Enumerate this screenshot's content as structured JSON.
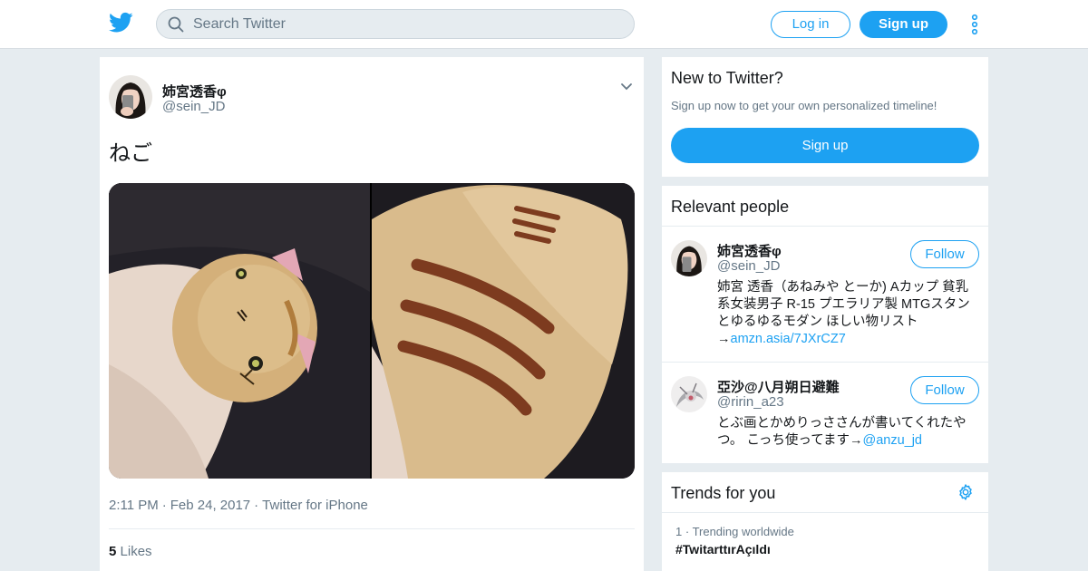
{
  "header": {
    "logo_icon": "twitter-bird-icon",
    "search_placeholder": "Search Twitter",
    "login_label": "Log in",
    "signup_label": "Sign up",
    "brand_color": "#1da1f2"
  },
  "tweet": {
    "author_name": "姉宮透香φ",
    "author_handle": "@sein_JD",
    "text": "ねご",
    "time": "2:11 PM",
    "date": "Feb 24, 2017",
    "source": "Twitter for iPhone",
    "likes_count": "5",
    "likes_label": "Likes"
  },
  "new_to_twitter": {
    "title": "New to Twitter?",
    "subtitle": "Sign up now to get your own personalized timeline!",
    "button_label": "Sign up"
  },
  "relevant_people": {
    "title": "Relevant people",
    "people": [
      {
        "name": "姉宮透香φ",
        "handle": "@sein_JD",
        "follow_label": "Follow",
        "bio_text": "姉宮 透香（あねみや とーか) Aカップ 貧乳系女装男子 R-15 プエラリア製 MTGスタンとゆるゆるモダン ほしい物リスト→",
        "bio_link": "amzn.asia/7JXrCZ7"
      },
      {
        "name": "亞沙@八月朔日避難",
        "handle": "@ririn_a23",
        "follow_label": "Follow",
        "bio_text": "とぶ画とかめりっささんが書いてくれたやつ。 こっち使ってます→",
        "bio_link": "@anzu_jd"
      }
    ]
  },
  "trends": {
    "title": "Trends for you",
    "items": [
      {
        "rank": "1",
        "context": "Trending worldwide",
        "tag": "#TwitarttırAçıldı"
      }
    ]
  }
}
